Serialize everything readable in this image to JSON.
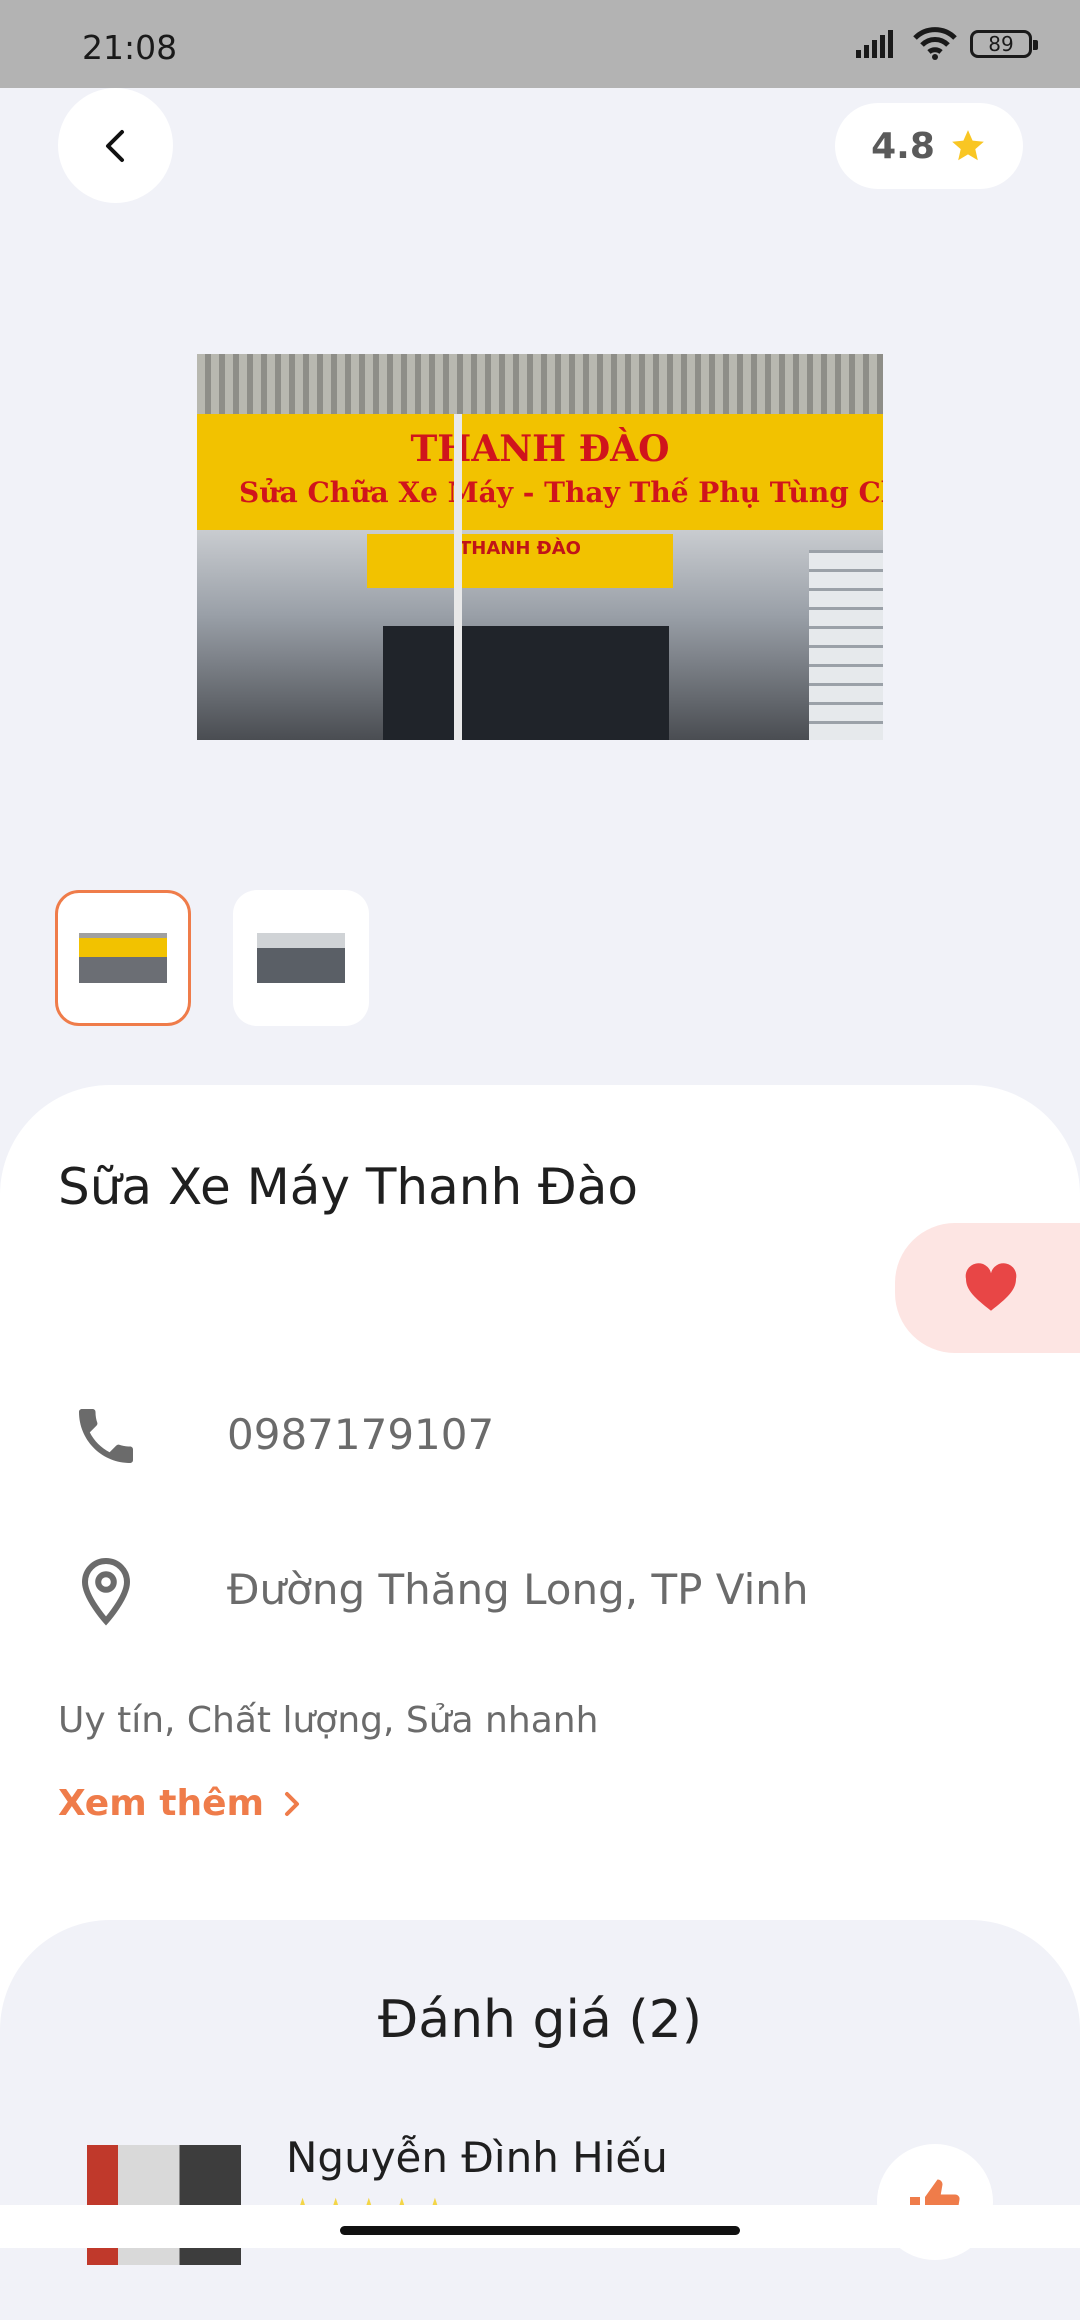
{
  "status_bar": {
    "time": "21:08",
    "battery": "89"
  },
  "header": {
    "rating": "4.8"
  },
  "hero_image": {
    "sign_title": "THANH ĐÀO",
    "sign_subtitle": "Sửa Chữa Xe Máy - Thay Thế Phụ Tùng Chính Hãng",
    "inner_sign": "THANH ĐÀO"
  },
  "shop": {
    "name": "Sữa Xe Máy Thanh Đào",
    "phone": "0987179107",
    "address": "Đường Thăng Long, TP Vinh",
    "description": "Uy tín, Chất lượng, Sửa nhanh",
    "see_more": "Xem thêm"
  },
  "reviews": {
    "title": "Đánh giá (2)",
    "items": [
      {
        "name": "Nguyễn Đình Hiếu",
        "stars": "★★★★★"
      }
    ]
  },
  "colors": {
    "accent": "#ef7c4a",
    "favorite": "#e84646",
    "star": "#f9c623"
  }
}
